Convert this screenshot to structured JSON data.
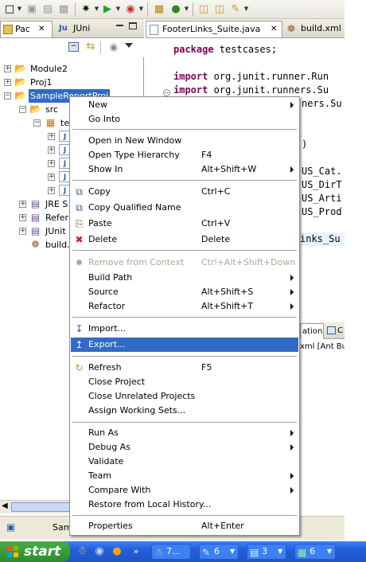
{
  "left_panel": {
    "tabs": [
      {
        "label": "Pac",
        "active": true
      },
      {
        "label": "JUni",
        "active": false
      }
    ],
    "tree": [
      {
        "label": "Module2"
      },
      {
        "label": "Proj1"
      },
      {
        "label": "SampleReportProj",
        "selected": true
      },
      {
        "label": "src"
      },
      {
        "label": "te"
      },
      {
        "label": "J"
      },
      {
        "label": "J"
      },
      {
        "label": "J"
      },
      {
        "label": "J"
      },
      {
        "label": "J"
      },
      {
        "label": "JRE S"
      },
      {
        "label": "Refer"
      },
      {
        "label": "JUnit"
      },
      {
        "label": "build."
      }
    ]
  },
  "editor": {
    "tabs": [
      {
        "label": "FooterLinks_Suite.java",
        "active": true
      },
      {
        "label": "build.xml",
        "active": false
      }
    ],
    "code": {
      "line1_kw": "package",
      "line1_rest": " testcases;",
      "line2_kw": "import",
      "line2_rest": " org.junit.runner.Run",
      "line3_kw": "import",
      "line3_rest": " org.junit.runners.Su",
      "line4_rest": "ners.Su",
      "line5_rest": ")",
      "line6_rest": "US_Cat.",
      "line7_rest": "US_DirT",
      "line8_rest": "US_Arti",
      "line9_rest": "US_Prod",
      "line10_rest": "inks_Su"
    }
  },
  "console": {
    "tab_label": "ation",
    "tab2_label": "C",
    "content": "xml [Ant Build"
  },
  "statusbar": {
    "text": "Sam"
  },
  "context_menu": {
    "items": [
      {
        "label": "New",
        "accel": "",
        "submenu": true
      },
      {
        "label": "Go Into",
        "accel": ""
      },
      {
        "label": "Open in New Window",
        "accel": ""
      },
      {
        "label": "Open Type Hierarchy",
        "accel": "F4"
      },
      {
        "label": "Show In",
        "accel": "Alt+Shift+W",
        "submenu": true
      },
      {
        "label": "Copy",
        "accel": "Ctrl+C",
        "icon": "copy-icon"
      },
      {
        "label": "Copy Qualified Name",
        "accel": "",
        "icon": "copy-qualified-icon"
      },
      {
        "label": "Paste",
        "accel": "Ctrl+V",
        "icon": "paste-icon"
      },
      {
        "label": "Delete",
        "accel": "Delete",
        "icon": "delete-icon"
      },
      {
        "label": "Remove from Context",
        "accel": "Ctrl+Alt+Shift+Down",
        "disabled": true,
        "icon": "remove-context-icon"
      },
      {
        "label": "Build Path",
        "accel": "",
        "submenu": true
      },
      {
        "label": "Source",
        "accel": "Alt+Shift+S",
        "submenu": true
      },
      {
        "label": "Refactor",
        "accel": "Alt+Shift+T",
        "submenu": true
      },
      {
        "label": "Import...",
        "accel": "",
        "icon": "import-icon"
      },
      {
        "label": "Export...",
        "accel": "",
        "icon": "export-icon",
        "highlighted": true
      },
      {
        "label": "Refresh",
        "accel": "F5",
        "icon": "refresh-icon"
      },
      {
        "label": "Close Project",
        "accel": ""
      },
      {
        "label": "Close Unrelated Projects",
        "accel": ""
      },
      {
        "label": "Assign Working Sets...",
        "accel": ""
      },
      {
        "label": "Run As",
        "accel": "",
        "submenu": true
      },
      {
        "label": "Debug As",
        "accel": "",
        "submenu": true
      },
      {
        "label": "Validate",
        "accel": ""
      },
      {
        "label": "Team",
        "accel": "",
        "submenu": true
      },
      {
        "label": "Compare With",
        "accel": "",
        "submenu": true
      },
      {
        "label": "Restore from Local History...",
        "accel": ""
      },
      {
        "label": "Properties",
        "accel": "Alt+Enter"
      }
    ]
  },
  "taskbar": {
    "start_label": "start",
    "buttons": [
      {
        "label": "7..."
      },
      {
        "label": "6"
      },
      {
        "label": "3"
      },
      {
        "label": "6"
      }
    ]
  },
  "colors": {
    "selection": "#316ac5",
    "keyword": "#7f0055",
    "taskbar": "#245edb",
    "start": "#379e37"
  }
}
